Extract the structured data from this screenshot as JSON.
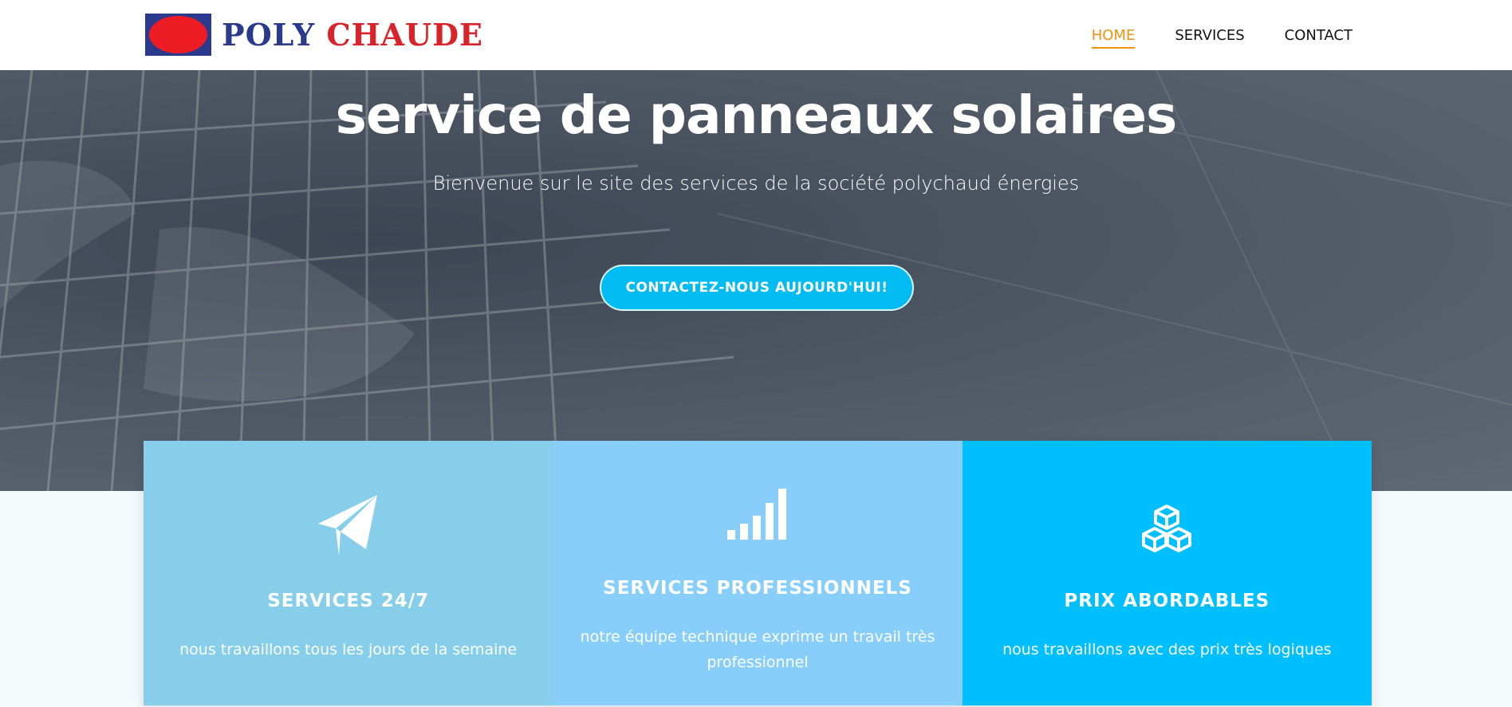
{
  "header": {
    "logo_part1": "POLY",
    "logo_part2": "CHAUDE",
    "nav": [
      {
        "label": "HOME",
        "active": true
      },
      {
        "label": "SERVICES",
        "active": false
      },
      {
        "label": "CONTACT",
        "active": false
      }
    ]
  },
  "hero": {
    "title": "service de panneaux solaires",
    "subtitle": "Bienvenue sur le site des services de la société polychaud énergies",
    "cta_label": "CONTACTEZ-NOUS AUJOURD'HUI!"
  },
  "features": [
    {
      "icon": "paper-plane-icon",
      "title": "SERVICES 24/7",
      "text": "nous travaillons tous les jours de la semaine"
    },
    {
      "icon": "signal-bars-icon",
      "title": "SERVICES PROFESSIONNELS",
      "text": "notre équipe technique exprime un travail très professionnel"
    },
    {
      "icon": "cubes-icon",
      "title": "PRIX ABORDABLES",
      "text": "nous travaillons avec des prix très logiques"
    }
  ],
  "colors": {
    "accent_orange": "#f29111",
    "cta_blue": "#00bcf2",
    "feature_1_bg": "#87ceeb",
    "feature_2_bg": "#87cefa",
    "feature_3_bg": "#00bfff"
  }
}
